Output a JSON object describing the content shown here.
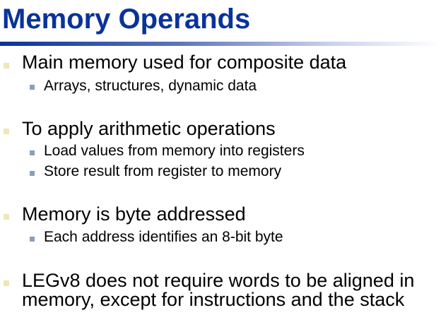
{
  "slide": {
    "title": "Memory Operands",
    "bullets": [
      {
        "text": "Main memory used for composite data",
        "subs": [
          "Arrays, structures, dynamic data"
        ]
      },
      {
        "text": "To apply arithmetic operations",
        "subs": [
          "Load values from memory into registers",
          "Store result from register to memory"
        ]
      },
      {
        "text": "Memory is byte addressed",
        "subs": [
          "Each address identifies an 8-bit byte"
        ]
      },
      {
        "text_lines": [
          "LEGv8 does not require words to be aligned in",
          "memory, except for instructions and the stack"
        ]
      }
    ]
  },
  "colors": {
    "title": "#0a3399",
    "bullet": "#ece8b8",
    "sub_bullet": "#8b9fb6"
  }
}
